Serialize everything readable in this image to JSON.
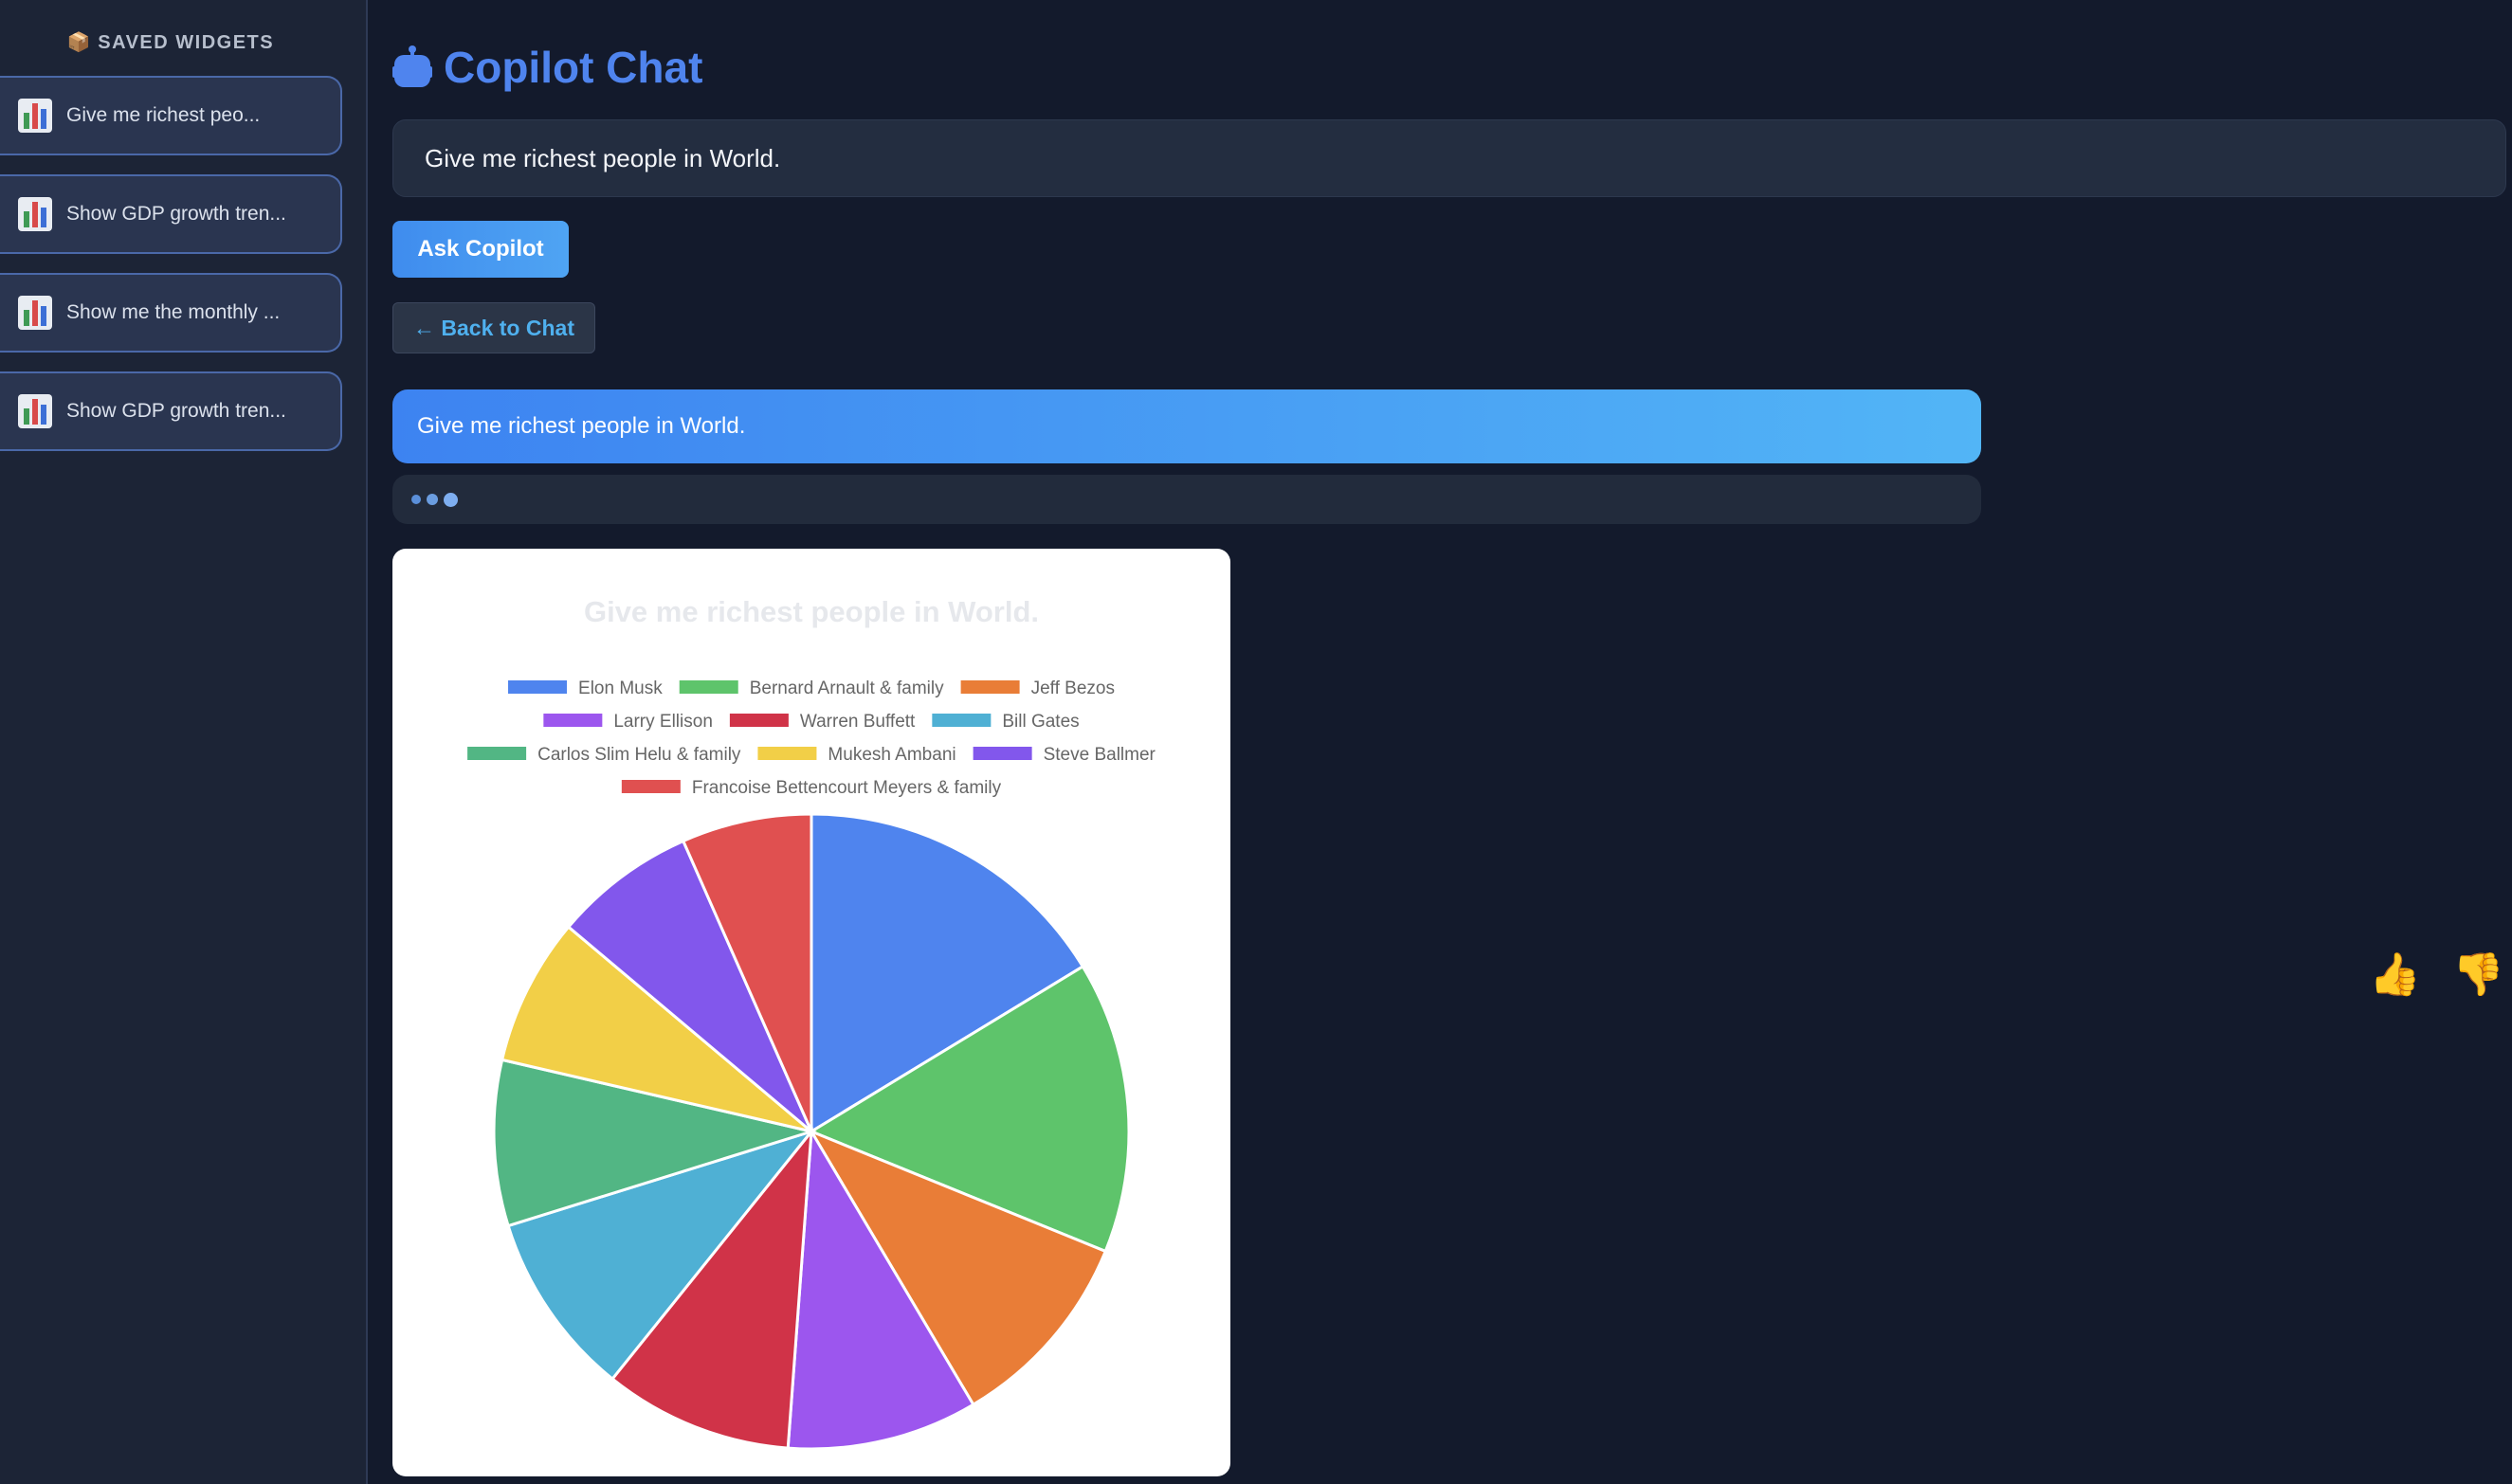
{
  "sidebar": {
    "title": "SAVED WIDGETS",
    "items": [
      {
        "label": "Give me richest peo..."
      },
      {
        "label": "Show GDP growth tren..."
      },
      {
        "label": "Show me the monthly ..."
      },
      {
        "label": "Show GDP growth tren..."
      }
    ]
  },
  "header": {
    "title": "Copilot Chat"
  },
  "chat": {
    "input_value": "Give me richest people in World.",
    "ask_button": "Ask Copilot",
    "back_button": "← Back to Chat",
    "user_message": "Give me richest people in World."
  },
  "feedback": {
    "up": "👍",
    "down": "👎"
  },
  "chart_data": {
    "type": "pie",
    "title": "Give me richest people in World.",
    "legend_position": "top",
    "categories": [
      "Elon Musk",
      "Bernard Arnault & family",
      "Jeff Bezos",
      "Larry Ellison",
      "Warren Buffett",
      "Bill Gates",
      "Carlos Slim Helu & family",
      "Mukesh Ambani",
      "Steve Ballmer",
      "Francoise Bettencourt Meyers & family"
    ],
    "values": [
      180,
      164,
      114,
      107,
      106,
      104,
      93,
      83,
      80,
      73
    ],
    "colors": [
      "#4f84ee",
      "#5ec46b",
      "#e97d37",
      "#9c56ee",
      "#d03348",
      "#4fb0d4",
      "#52b684",
      "#f2cf47",
      "#8257ec",
      "#e05050"
    ]
  }
}
